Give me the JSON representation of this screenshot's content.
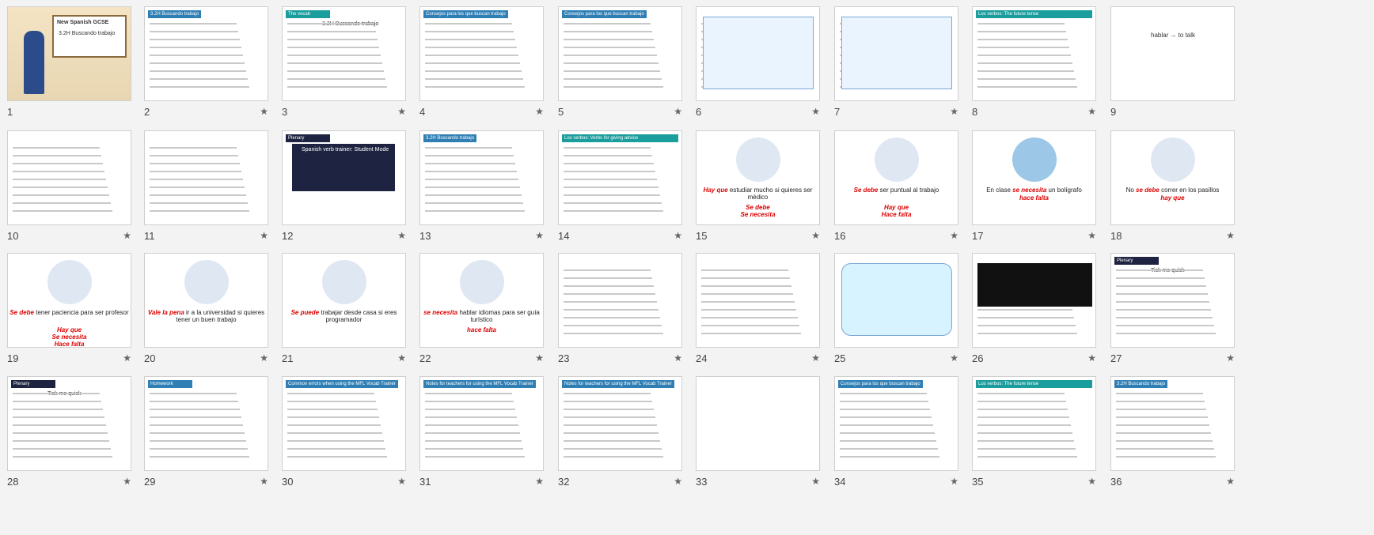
{
  "slides": [
    {
      "n": "1",
      "star": false,
      "title": "New Spanish GCSE",
      "sub": "3.2H Buscando trabajo"
    },
    {
      "n": "2",
      "star": true,
      "title": "3.2H Buscando trabajo"
    },
    {
      "n": "3",
      "star": true,
      "title": "The vocab",
      "sub": "3.2H Buscando trabajo"
    },
    {
      "n": "4",
      "star": true,
      "title": "Consejos para los que buscan trabajo"
    },
    {
      "n": "5",
      "star": true,
      "title": "Consejos para los que buscan trabajo"
    },
    {
      "n": "6",
      "star": true,
      "title": ""
    },
    {
      "n": "7",
      "star": true,
      "title": ""
    },
    {
      "n": "8",
      "star": true,
      "title": "Los verbos: The future tense"
    },
    {
      "n": "9",
      "star": false,
      "title": "",
      "sub": "hablar → to talk"
    },
    {
      "n": "10",
      "star": true,
      "title": ""
    },
    {
      "n": "11",
      "star": true,
      "title": ""
    },
    {
      "n": "12",
      "star": true,
      "title": "Plenary",
      "sub": "Spanish verb trainer: Student Mode"
    },
    {
      "n": "13",
      "star": true,
      "title": "3.2H Buscando trabajo"
    },
    {
      "n": "14",
      "star": true,
      "title": "Los verbos: Verbs for giving advice"
    },
    {
      "n": "15",
      "star": true,
      "c1": "Hay que",
      "c2": "estudiar mucho si quieres ser médico",
      "c3": "Se debe",
      "c4": "Se necesita"
    },
    {
      "n": "16",
      "star": true,
      "c1": "Se debe",
      "c2": "ser puntual al trabajo",
      "c3": "Hay que",
      "c4": "Hace falta"
    },
    {
      "n": "17",
      "star": true,
      "c1": "se necesita",
      "c2": "En clase",
      "c3": "un bolígrafo",
      "c4": "hace falta"
    },
    {
      "n": "18",
      "star": true,
      "c1": "se debe",
      "c2": "No",
      "c3": "correr en los pasillos",
      "c4": "hay que"
    },
    {
      "n": "19",
      "star": true,
      "c1": "Se debe",
      "c2": "tener paciencia para ser profesor",
      "c3": "Hay que",
      "c4": "Se necesita",
      "c5": "Hace falta"
    },
    {
      "n": "20",
      "star": true,
      "c1": "Vale la pena",
      "c2": "ir a la universidad si quieres tener un buen trabajo"
    },
    {
      "n": "21",
      "star": true,
      "c1": "Se puede",
      "c2": "trabajar desde casa si eres programador"
    },
    {
      "n": "22",
      "star": true,
      "c1": "se necesita",
      "c2": "hablar idiomas para ser guía turístico",
      "c3": "hace falta"
    },
    {
      "n": "23",
      "star": true,
      "title": ""
    },
    {
      "n": "24",
      "star": true,
      "title": ""
    },
    {
      "n": "25",
      "star": true,
      "title": ""
    },
    {
      "n": "26",
      "star": true,
      "title": ""
    },
    {
      "n": "27",
      "star": true,
      "title": "Plenary",
      "sub": "Tick me quick"
    },
    {
      "n": "28",
      "star": true,
      "title": "Plenary",
      "sub": "Tick me quick"
    },
    {
      "n": "29",
      "star": true,
      "title": "Homework"
    },
    {
      "n": "30",
      "star": true,
      "title": "Common errors when using the MFL Vocab Trainer"
    },
    {
      "n": "31",
      "star": true,
      "title": "Notes for teachers for using the MFL Vocab Trainer"
    },
    {
      "n": "32",
      "star": true,
      "title": "Notes for teachers for using the MFL Vocab Trainer"
    },
    {
      "n": "33",
      "star": true,
      "title": ""
    },
    {
      "n": "34",
      "star": true,
      "title": "Consejos para los que buscan trabajo"
    },
    {
      "n": "35",
      "star": true,
      "title": "Los verbos: The future tense"
    },
    {
      "n": "36",
      "star": true,
      "title": "3.2H Buscando trabajo"
    }
  ],
  "colors": {
    "accent": "#2f7fb5",
    "highlight": "#d00000",
    "teal": "#1a9d9d",
    "navy": "#1d2340"
  }
}
